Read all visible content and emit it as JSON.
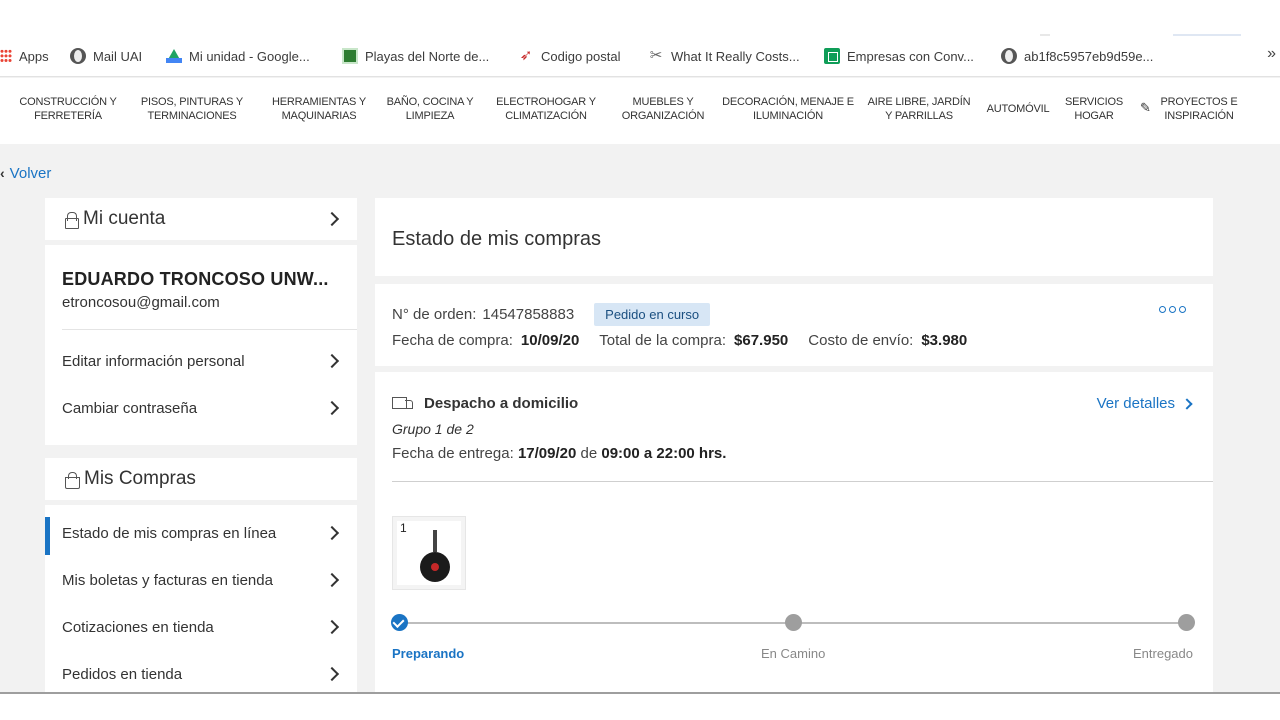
{
  "bookmarks": [
    {
      "label": "Apps",
      "icon": "apps-icon"
    },
    {
      "label": "Mail UAI",
      "icon": "globe-icon"
    },
    {
      "label": "Mi unidad - Google...",
      "icon": "google-drive-icon"
    },
    {
      "label": "Playas del Norte de...",
      "icon": "beach-icon"
    },
    {
      "label": "Codigo postal",
      "icon": "bird-icon"
    },
    {
      "label": "What It Really Costs...",
      "icon": "scissors-icon"
    },
    {
      "label": "Empresas con Conv...",
      "icon": "google-sheets-icon"
    },
    {
      "label": "ab1f8c5957eb9d59e...",
      "icon": "globe-icon"
    }
  ],
  "bookmarks_more": "»",
  "categories": [
    "CONSTRUCCIÓN Y FERRETERÍA",
    "PISOS, PINTURAS Y TERMINACIONES",
    "HERRAMIENTAS Y MAQUINARIAS",
    "BAÑO, COCINA Y LIMPIEZA",
    "ELECTROHOGAR Y CLIMATIZACIÓN",
    "MUEBLES Y ORGANIZACIÓN",
    "DECORACIÓN, MENAJE E ILUMINACIÓN",
    "AIRE LIBRE, JARDÍN Y PARRILLAS",
    "AUTOMÓVIL",
    "SERVICIOS HOGAR",
    "PROYECTOS E INSPIRACIÓN"
  ],
  "back_label": "Volver",
  "account": {
    "title": "Mi cuenta",
    "name": "EDUARDO TRONCOSO UNW...",
    "email": "etroncosou@gmail.com",
    "items": [
      "Editar información personal",
      "Cambiar contraseña"
    ]
  },
  "purchases": {
    "title": "Mis Compras",
    "items": [
      "Estado de mis compras en línea",
      "Mis boletas y facturas en tienda",
      "Cotizaciones en tienda",
      "Pedidos en tienda"
    ],
    "active_index": 0
  },
  "main": {
    "title": "Estado de mis compras",
    "order_label": "N° de orden:",
    "order_number": "14547858883",
    "status_badge": "Pedido en curso",
    "purchase_date_label": "Fecha de compra:",
    "purchase_date": "10/09/20",
    "total_label": "Total de la compra:",
    "total": "$67.950",
    "shipping_label": "Costo de envío:",
    "shipping": "$3.980",
    "delivery_type": "Despacho a domicilio",
    "details_link": "Ver detalles",
    "group": "Grupo 1 de 2",
    "delivery_date_label": "Fecha de entrega:",
    "delivery_date": "17/09/20",
    "delivery_from_word": "de",
    "delivery_window": "09:00 a 22:00 hrs.",
    "product_qty": "1",
    "steps": [
      "Preparando",
      "En Camino",
      "Entregado"
    ],
    "current_step": 0
  },
  "colors": {
    "accent": "#1a74c4",
    "badge_bg": "#d7e6f5",
    "page_bg": "#f2f2f2"
  }
}
